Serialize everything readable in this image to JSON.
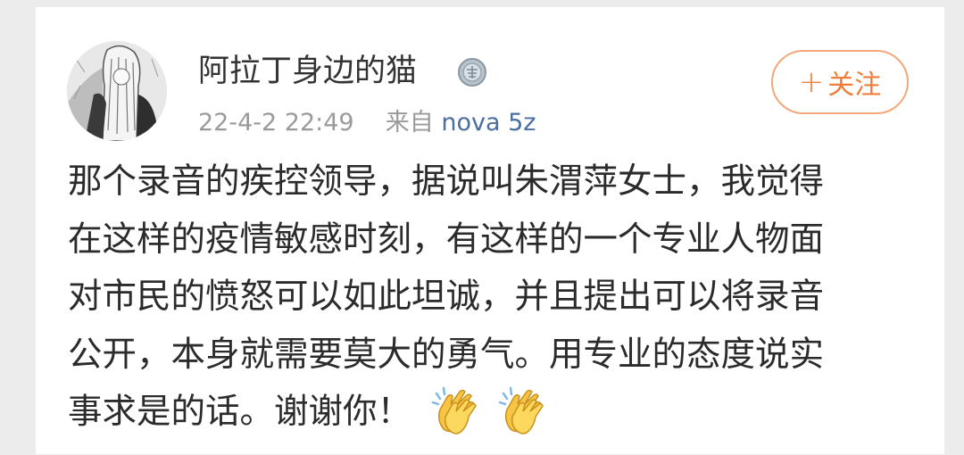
{
  "post": {
    "author_name": "阿拉丁身边的猫",
    "badge_icon": "medal-badge-icon",
    "timestamp": "22-4-2 22:49",
    "source_prefix": "来自",
    "source_device": "nova 5z",
    "follow_plus": "+",
    "follow_label": "关注",
    "body_lines": [
      "那个录音的疾控领导，据说叫朱渭萍女士，我觉得",
      "在这样的疫情敏感时刻，有这样的一个专业人物面",
      "对市民的愤怒可以如此坦诚，并且提出可以将录音",
      "公开，本身就需要莫大的勇气。用专业的态度说实",
      "事求是的话。谢谢你！"
    ],
    "emoji": [
      "clapping-hands-icon",
      "clapping-hands-icon"
    ]
  },
  "colors": {
    "follow_accent": "#f07e3a",
    "follow_border": "#f2a878",
    "source_link": "#4a6fa0",
    "meta_gray": "#9a9a9a"
  }
}
